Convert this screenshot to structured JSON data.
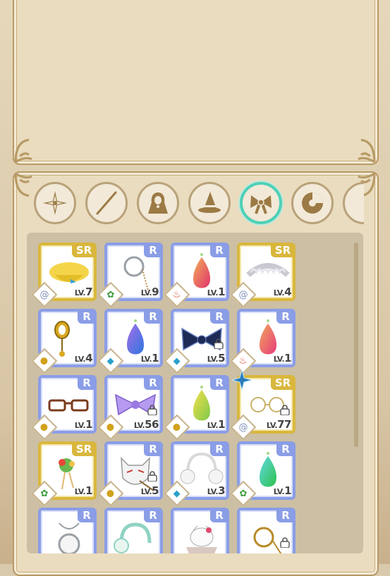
{
  "tabs": [
    {
      "name": "compass-star-icon",
      "active": false
    },
    {
      "name": "wand-icon",
      "active": false
    },
    {
      "name": "hooded-cloak-icon",
      "active": false
    },
    {
      "name": "witch-hat-icon",
      "active": false
    },
    {
      "name": "ribbon-bow-icon",
      "active": true
    },
    {
      "name": "orb-icon",
      "active": false
    },
    {
      "name": "partial-tab-icon",
      "active": false
    }
  ],
  "colors": {
    "rarity_r": "#8a9de6",
    "rarity_sr": "#d9b73d",
    "active_tab": "#4fd0b6"
  },
  "items": [
    {
      "rarity": "SR",
      "level": "7",
      "prefix": "LV.",
      "element": "wind-swirl-icon",
      "art": "yellow-beret",
      "locked": false
    },
    {
      "rarity": "R",
      "level": "9",
      "prefix": "LV.",
      "element": "leaf-icon",
      "art": "monocle-chain",
      "locked": false
    },
    {
      "rarity": "R",
      "level": "1",
      "prefix": "LV.",
      "element": "fire-icon",
      "art": "red-gem",
      "locked": false
    },
    {
      "rarity": "SR",
      "level": "4",
      "prefix": "LV.",
      "element": "wind-swirl-icon",
      "art": "maid-headdress",
      "locked": false
    },
    {
      "rarity": "R",
      "level": "4",
      "prefix": "LV.",
      "element": "coin-icon",
      "art": "gold-earring",
      "locked": false
    },
    {
      "rarity": "R",
      "level": "1",
      "prefix": "LV.",
      "element": "water-icon",
      "art": "blue-gem",
      "locked": false
    },
    {
      "rarity": "R",
      "level": "5",
      "prefix": "LV.",
      "element": "water-icon",
      "art": "navy-bow",
      "locked": true
    },
    {
      "rarity": "R",
      "level": "1",
      "prefix": "LV.",
      "element": "fire-icon",
      "art": "pink-gem",
      "locked": false
    },
    {
      "rarity": "R",
      "level": "1",
      "prefix": "LV.",
      "element": "coin-icon",
      "art": "glasses",
      "locked": false
    },
    {
      "rarity": "R",
      "level": "56",
      "prefix": "LV.",
      "element": "coin-icon",
      "art": "purple-bow",
      "locked": true
    },
    {
      "rarity": "R",
      "level": "1",
      "prefix": "LV.",
      "element": "coin-icon",
      "art": "yellow-gem",
      "locked": false
    },
    {
      "rarity": "SR",
      "level": "77",
      "prefix": "LV.",
      "element": "wind-swirl-icon",
      "art": "round-glasses",
      "locked": true
    },
    {
      "rarity": "SR",
      "level": "1",
      "prefix": "LV.",
      "element": "leaf-icon",
      "art": "flower-hairpin",
      "locked": false
    },
    {
      "rarity": "R",
      "level": "5",
      "prefix": "LV.",
      "element": "coin-icon",
      "art": "fox-mask",
      "locked": true
    },
    {
      "rarity": "R",
      "level": "3",
      "prefix": "LV.",
      "element": "water-icon",
      "art": "white-earmuffs",
      "locked": false
    },
    {
      "rarity": "R",
      "level": "1",
      "prefix": "LV.",
      "element": "leaf-icon",
      "art": "green-gem",
      "locked": false
    },
    {
      "rarity": "R",
      "level": "",
      "prefix": "",
      "element": "",
      "art": "pocket-watch",
      "locked": false
    },
    {
      "rarity": "R",
      "level": "",
      "prefix": "",
      "element": "",
      "art": "mint-earmuffs",
      "locked": false
    },
    {
      "rarity": "R",
      "level": "",
      "prefix": "",
      "element": "",
      "art": "hello-kitty-bow",
      "locked": false
    },
    {
      "rarity": "R",
      "level": "",
      "prefix": "",
      "element": "",
      "art": "gold-monocle",
      "locked": true
    }
  ]
}
